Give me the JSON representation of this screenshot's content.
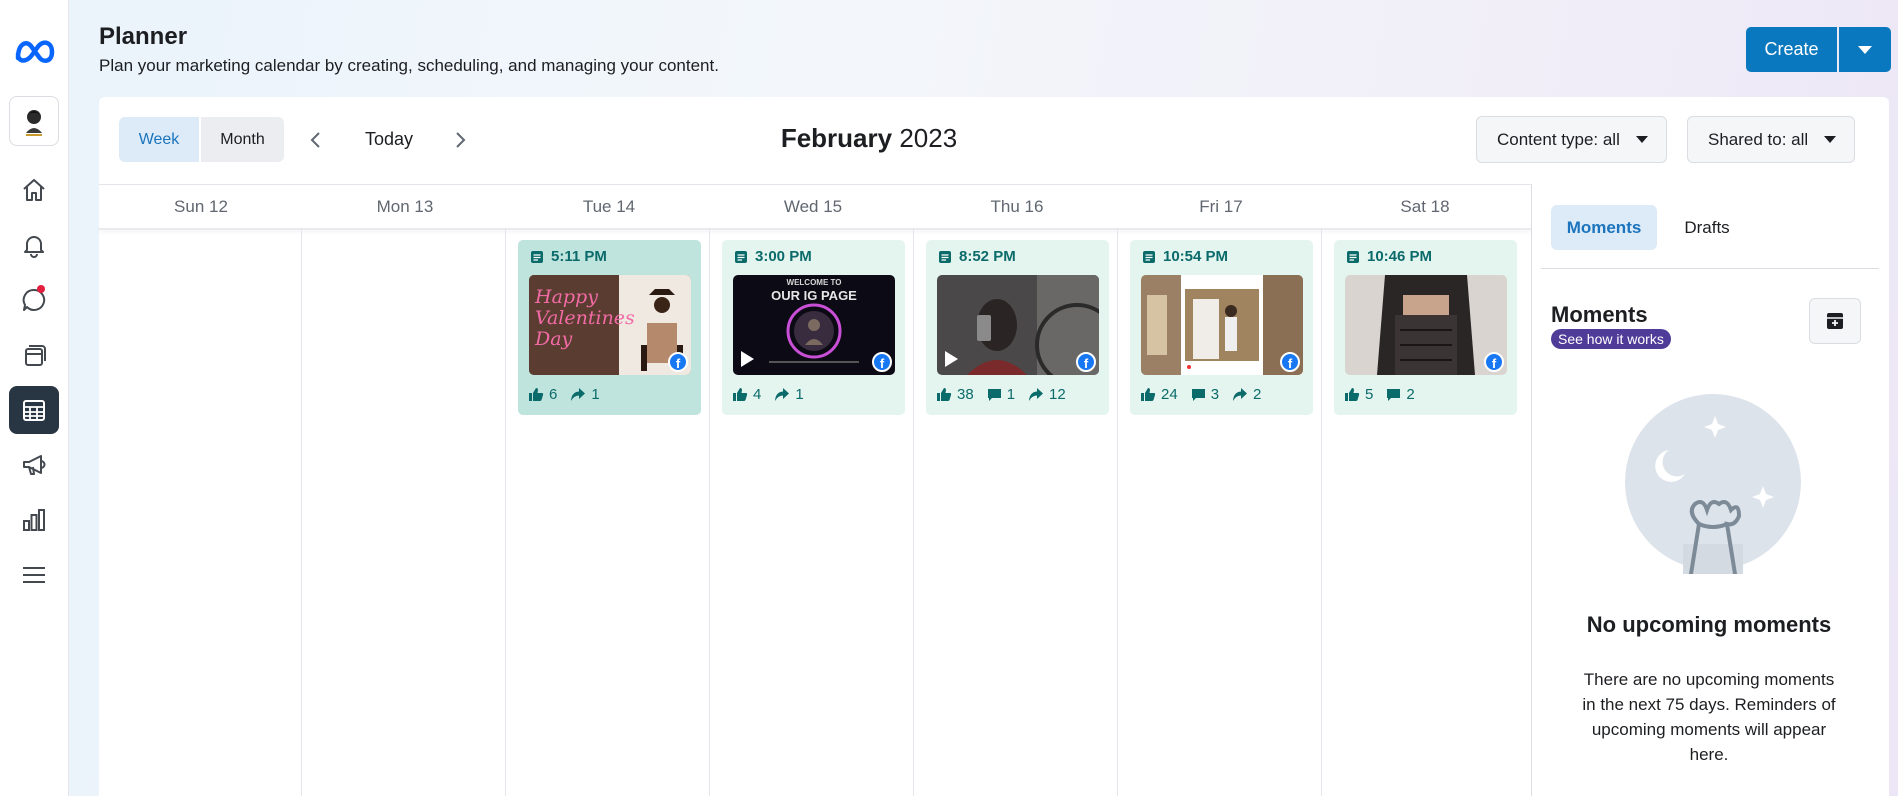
{
  "header": {
    "title": "Planner",
    "subtitle": "Plan your marketing calendar by creating, scheduling, and managing your content.",
    "create_label": "Create"
  },
  "sidebar": {
    "logo": "meta-logo",
    "items": [
      {
        "icon": "home-icon"
      },
      {
        "icon": "bell-icon"
      },
      {
        "icon": "chat-icon"
      },
      {
        "icon": "pages-icon"
      },
      {
        "icon": "calendar-icon",
        "active": true
      },
      {
        "icon": "megaphone-icon"
      },
      {
        "icon": "bar-chart-icon"
      },
      {
        "icon": "menu-icon"
      }
    ]
  },
  "toolbar": {
    "week_label": "Week",
    "month_label": "Month",
    "today_label": "Today",
    "month": "February",
    "year": "2023",
    "content_type_label": "Content type: all",
    "shared_to_label": "Shared to: all"
  },
  "days": [
    "Sun 12",
    "Mon 13",
    "Tue 14",
    "Wed 15",
    "Thu 16",
    "Fri 17",
    "Sat 18"
  ],
  "posts": [
    {
      "time": "5:11 PM",
      "likes": "6",
      "shares": "1"
    },
    {
      "time": "3:00 PM",
      "likes": "4",
      "shares": "1"
    },
    {
      "time": "8:52 PM",
      "likes": "38",
      "comments": "1",
      "shares": "12"
    },
    {
      "time": "10:54 PM",
      "likes": "24",
      "comments": "3",
      "shares": "2"
    },
    {
      "time": "10:46 PM",
      "likes": "5",
      "comments": "2"
    }
  ],
  "thumb_text": {
    "valentine": "Happy Valentines Day",
    "ig_line1": "WELCOME TO",
    "ig_line2": "OUR IG PAGE"
  },
  "right_panel": {
    "moments_tab": "Moments",
    "drafts_tab": "Drafts",
    "title": "Moments",
    "how_label": "See how it works",
    "empty_title": "No upcoming moments",
    "empty_desc": "There are no upcoming moments in the next 75 days. Reminders of upcoming moments will appear here."
  },
  "colors": {
    "primary": "#0a78be",
    "card_bg": "#e4f4ef",
    "card_selected": "#bfe3dd",
    "stat_text": "#0b6b6b",
    "pill": "#4f3c99"
  }
}
